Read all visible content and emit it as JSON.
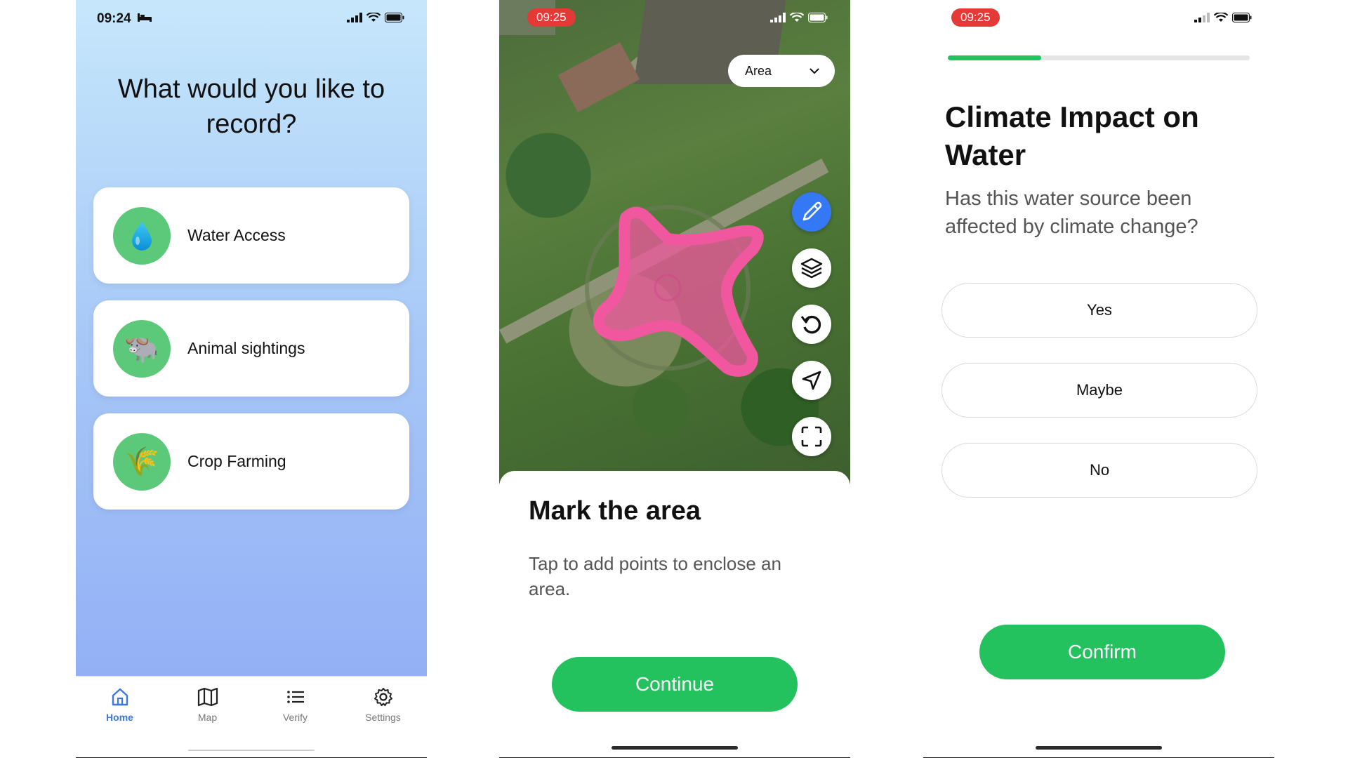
{
  "screen1": {
    "status_time": "09:24",
    "title": "What would you like to record?",
    "categories": [
      {
        "label": "Water Access",
        "icon": "water-drop-icon",
        "emoji": "💧"
      },
      {
        "label": "Animal sightings",
        "icon": "cow-icon",
        "emoji": "🐃"
      },
      {
        "label": "Crop Farming",
        "icon": "crop-icon",
        "emoji": "🌾"
      }
    ],
    "tabs": [
      {
        "label": "Home",
        "icon": "home-icon",
        "active": true
      },
      {
        "label": "Map",
        "icon": "map-icon",
        "active": false
      },
      {
        "label": "Verify",
        "icon": "list-icon",
        "active": false
      },
      {
        "label": "Settings",
        "icon": "gear-icon",
        "active": false
      }
    ]
  },
  "screen2": {
    "status_time": "09:25",
    "area_select": {
      "value": "Area"
    },
    "map_tools": [
      {
        "icon": "pencil-icon",
        "active": true
      },
      {
        "icon": "layers-icon",
        "active": false
      },
      {
        "icon": "undo-icon",
        "active": false
      },
      {
        "icon": "navigation-icon",
        "active": false
      },
      {
        "icon": "fullscreen-icon",
        "active": false
      }
    ],
    "sheet_title": "Mark the area",
    "sheet_text": "Tap to add points to enclose an area.",
    "continue_label": "Continue"
  },
  "screen3": {
    "status_time": "09:25",
    "progress": 0.31,
    "title": "Climate Impact on Water",
    "question": "Has this water source been affected by climate change?",
    "options": [
      "Yes",
      "Maybe",
      "No"
    ],
    "confirm_label": "Confirm"
  },
  "colors": {
    "accent_green": "#23c25f",
    "active_tab_blue": "#3d77e0",
    "recording_red": "#e53935",
    "area_pink": "#f0579f"
  }
}
